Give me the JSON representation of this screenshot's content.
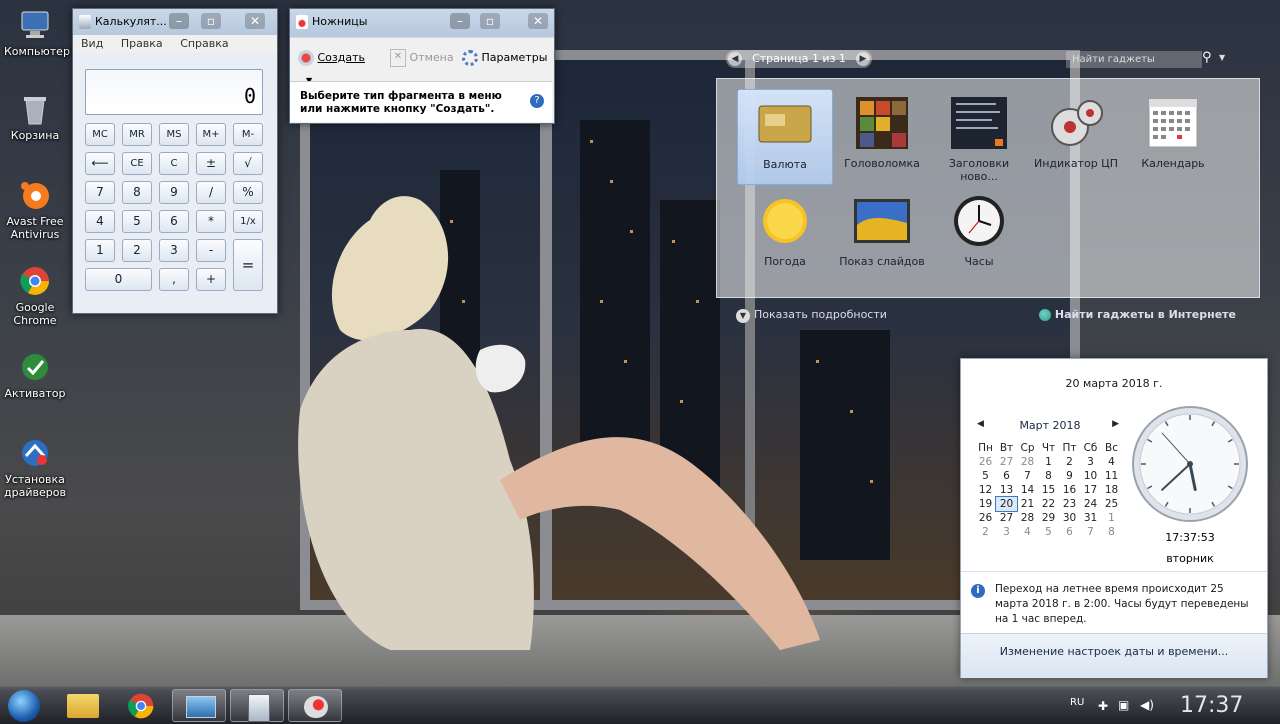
{
  "desktop": {
    "icons": [
      {
        "label": "Компьютер",
        "icon": "computer-icon"
      },
      {
        "label": "Корзина",
        "icon": "recycle-bin-icon"
      },
      {
        "label": "Avast Free Antivirus",
        "icon": "avast-icon"
      },
      {
        "label": "Google Chrome",
        "icon": "chrome-icon"
      },
      {
        "label": "Активатор",
        "icon": "activator-icon"
      },
      {
        "label": "Установка драйверов",
        "icon": "driver-install-icon"
      }
    ]
  },
  "calculator": {
    "title": "Калькулят...",
    "menu": [
      "Вид",
      "Правка",
      "Справка"
    ],
    "display": "0",
    "keys": {
      "mc": "MC",
      "mr": "MR",
      "ms": "MS",
      "mplus": "M+",
      "mminus": "M-",
      "back": "⟵",
      "ce": "CE",
      "c": "C",
      "pm": "±",
      "sqrt": "√",
      "k7": "7",
      "k8": "8",
      "k9": "9",
      "div": "/",
      "pct": "%",
      "k4": "4",
      "k5": "5",
      "k6": "6",
      "mul": "*",
      "inv": "1/x",
      "k1": "1",
      "k2": "2",
      "k3": "3",
      "sub": "-",
      "eq": "=",
      "k0": "0",
      "dot": ",",
      "add": "+"
    }
  },
  "snipping": {
    "title": "Ножницы",
    "new_label": "Создать",
    "cancel_label": "Отмена",
    "options_label": "Параметры",
    "message": "Выберите тип фрагмента в меню или нажмите кнопку \"Создать\"."
  },
  "gadgets": {
    "page_label": "Страница 1 из 1",
    "search_placeholder": "Найти гаджеты",
    "items": [
      {
        "label": "Валюта",
        "icon": "currency-gadget-icon",
        "selected": true
      },
      {
        "label": "Головоломка",
        "icon": "puzzle-gadget-icon"
      },
      {
        "label": "Заголовки ново...",
        "icon": "news-headlines-gadget-icon"
      },
      {
        "label": "Индикатор ЦП",
        "icon": "cpu-meter-gadget-icon"
      },
      {
        "label": "Календарь",
        "icon": "calendar-gadget-icon"
      },
      {
        "label": "Погода",
        "icon": "weather-gadget-icon"
      },
      {
        "label": "Показ слайдов",
        "icon": "slideshow-gadget-icon"
      },
      {
        "label": "Часы",
        "icon": "clock-gadget-icon"
      }
    ],
    "details_label": "Показать подробности",
    "online_label": "Найти гаджеты в Интернете"
  },
  "clock_flyout": {
    "full_date": "20 марта 2018 г.",
    "month_label": "Март 2018",
    "weekdays": [
      "Пн",
      "Вт",
      "Ср",
      "Чт",
      "Пт",
      "Сб",
      "Вс"
    ],
    "weeks": [
      [
        "26",
        "27",
        "28",
        "1",
        "2",
        "3",
        "4"
      ],
      [
        "5",
        "6",
        "7",
        "8",
        "9",
        "10",
        "11"
      ],
      [
        "12",
        "13",
        "14",
        "15",
        "16",
        "17",
        "18"
      ],
      [
        "19",
        "20",
        "21",
        "22",
        "23",
        "24",
        "25"
      ],
      [
        "26",
        "27",
        "28",
        "29",
        "30",
        "31",
        "1"
      ],
      [
        "2",
        "3",
        "4",
        "5",
        "6",
        "7",
        "8"
      ]
    ],
    "today": "20",
    "time": "17:37:53",
    "weekday": "вторник",
    "dst_notice": "Переход на летнее время происходит 25 марта 2018 г. в 2:00. Часы будут переведены на 1 час вперед.",
    "settings_link": "Изменение настроек даты и времени..."
  },
  "taskbar": {
    "language": "RU",
    "clock": "17:37",
    "buttons": [
      "start-orb-icon",
      "explorer-icon",
      "chrome-icon",
      "remote-desktop-icon",
      "calculator-icon",
      "snipping-tool-icon"
    ]
  }
}
